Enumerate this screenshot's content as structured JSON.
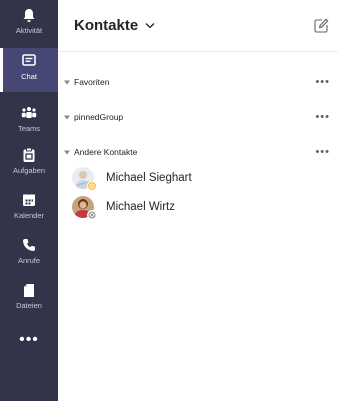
{
  "rail": {
    "items": [
      {
        "label": "Aktivität",
        "icon": "bell-icon"
      },
      {
        "label": "Chat",
        "icon": "chat-icon",
        "active": true
      },
      {
        "label": "Teams",
        "icon": "teams-icon"
      },
      {
        "label": "Aufgaben",
        "icon": "tasks-icon"
      },
      {
        "label": "Kalender",
        "icon": "calendar-icon"
      },
      {
        "label": "Anrufe",
        "icon": "phone-icon"
      },
      {
        "label": "Dateien",
        "icon": "files-icon"
      }
    ],
    "more_label": "•••"
  },
  "header": {
    "title": "Kontakte",
    "compose_icon": "compose-icon"
  },
  "groups": [
    {
      "name": "Favoriten",
      "more": "•••"
    },
    {
      "name": "pinnedGroup",
      "more": "•••"
    },
    {
      "name": "Andere Kontakte",
      "more": "•••"
    }
  ],
  "contacts": [
    {
      "name": "Michael Sieghart",
      "status": "away"
    },
    {
      "name": "Michael Wirtz",
      "status": "offline"
    }
  ],
  "colors": {
    "rail_bg": "#33344a",
    "rail_active": "#464775",
    "away": "#f8c43a",
    "offline": "#8a8886"
  }
}
